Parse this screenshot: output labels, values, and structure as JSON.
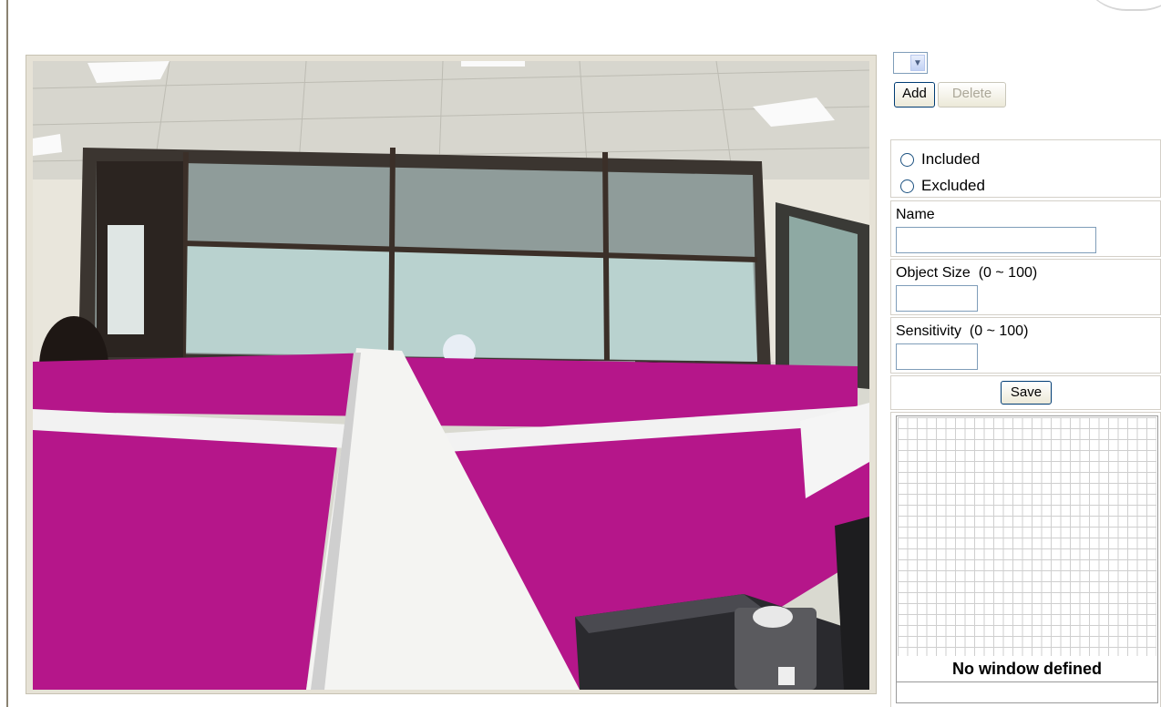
{
  "zone_selector": {
    "value": "",
    "icon": "chevron-down-icon"
  },
  "buttons": {
    "add": "Add",
    "delete": "Delete",
    "save": "Save"
  },
  "window_type": {
    "options": [
      "Included",
      "Excluded"
    ]
  },
  "fields": {
    "name": {
      "label": "Name",
      "value": ""
    },
    "object_size": {
      "label": "Object Size  (0 ~ 100)",
      "value": ""
    },
    "sensitivity": {
      "label": "Sensitivity  (0 ~ 100)",
      "value": ""
    }
  },
  "grid": {
    "message": "No window defined"
  },
  "colors": {
    "partition": "#b5168a",
    "accent_border": "#7f9db9",
    "button_border": "#003c74"
  }
}
